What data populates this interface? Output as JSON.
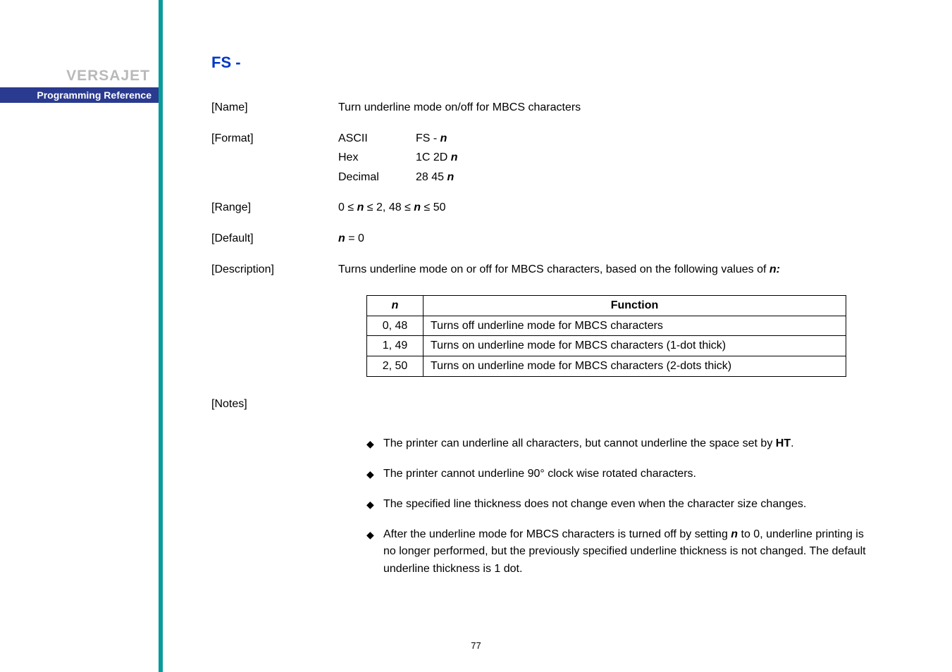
{
  "sidebar": {
    "brand": "VERSAJET",
    "reference": "Programming Reference"
  },
  "command": "FS -",
  "name": {
    "label": "[Name]",
    "value": "Turn underline mode on/off for MBCS characters"
  },
  "format": {
    "label": "[Format]",
    "rows": [
      {
        "enc": "ASCII",
        "val": "FS - n"
      },
      {
        "enc": "Hex",
        "val": "1C 2D n"
      },
      {
        "enc": "Decimal",
        "val": "28 45 n"
      }
    ]
  },
  "range": {
    "label": "[Range]",
    "value": "0 ≤ n ≤ 2, 48 ≤ n ≤ 50"
  },
  "default": {
    "label": "[Default]",
    "prefix": "n",
    "suffix": " = 0"
  },
  "description": {
    "label": "[Description]",
    "value_pre": "Turns underline mode on or off for MBCS characters, based on the following values of ",
    "value_var": "n:"
  },
  "func_table": {
    "head_n": "n",
    "head_f": "Function",
    "rows": [
      {
        "n": "0, 48",
        "f": "Turns off underline mode for MBCS characters"
      },
      {
        "n": "1, 49",
        "f": "Turns on underline mode for MBCS characters (1-dot thick)"
      },
      {
        "n": "2, 50",
        "f": "Turns on underline mode for MBCS characters (2-dots thick)"
      }
    ]
  },
  "notes": {
    "label": "[Notes]",
    "items": {
      "n0_pre": "The printer can underline all characters, but cannot underline the space set by ",
      "n0_bold": "HT",
      "n0_post": ".",
      "n1": "The printer cannot underline 90° clock wise rotated characters.",
      "n2": "The specified line thickness does not change even when the character size changes.",
      "n3_pre": "After the underline mode for MBCS characters is turned off by setting ",
      "n3_var": "n",
      "n3_post": " to 0, underline printing is no longer performed, but the previously specified underline thickness is not changed. The default underline thickness is 1 dot."
    }
  },
  "page": "77"
}
